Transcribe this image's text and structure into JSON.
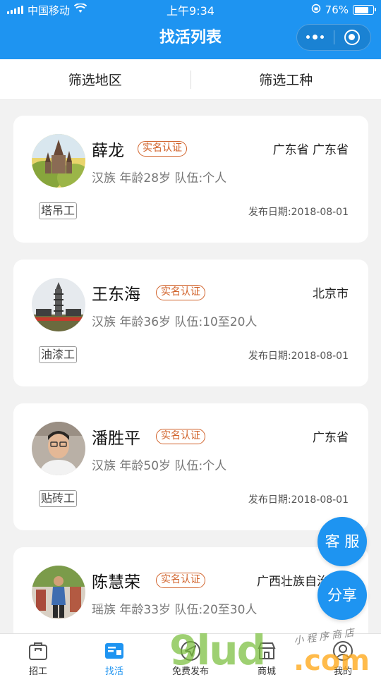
{
  "status_bar": {
    "carrier": "中国移动",
    "time": "上午9:34",
    "battery": "76%",
    "battery_level": 0.76
  },
  "navbar": {
    "title": "找活列表"
  },
  "filters": [
    {
      "label": "筛选地区"
    },
    {
      "label": "筛选工种"
    }
  ],
  "workers": [
    {
      "name": "薛龙",
      "badge": "实名认证",
      "region": "广东省 广东省",
      "info": "汉族 年龄28岁 队伍:个人",
      "tag": "塔吊工",
      "date": "发布日期:2018-08-01"
    },
    {
      "name": "王东海",
      "badge": "实名认证",
      "region": "北京市",
      "info": "汉族 年龄36岁 队伍:10至20人",
      "tag": "油漆工",
      "date": "发布日期:2018-08-01"
    },
    {
      "name": "潘胜平",
      "badge": "实名认证",
      "region": "广东省",
      "info": "汉族 年龄50岁 队伍:个人",
      "tag": "贴砖工",
      "date": "发布日期:2018-08-01"
    },
    {
      "name": "陈慧荣",
      "badge": "实名认证",
      "region": "广西壮族自治",
      "info": "瑶族 年龄33岁 队伍:20至30人",
      "tag": "",
      "date": ""
    }
  ],
  "float_buttons": {
    "service": "客 服",
    "share": "分享"
  },
  "tabbar": [
    {
      "label": "招工",
      "icon": "briefcase-icon"
    },
    {
      "label": "找活",
      "icon": "id-card-icon",
      "active": true
    },
    {
      "label": "免费发布",
      "icon": "paper-plane-icon"
    },
    {
      "label": "商城",
      "icon": "shop-icon"
    },
    {
      "label": "我的",
      "icon": "user-icon"
    }
  ],
  "watermark": {
    "main": "9lud",
    "suffix": ".com",
    "sub": "小程序商店"
  },
  "colors": {
    "brand": "#1e94f1",
    "badge": "#d1622a",
    "background": "#f2f2f2"
  }
}
